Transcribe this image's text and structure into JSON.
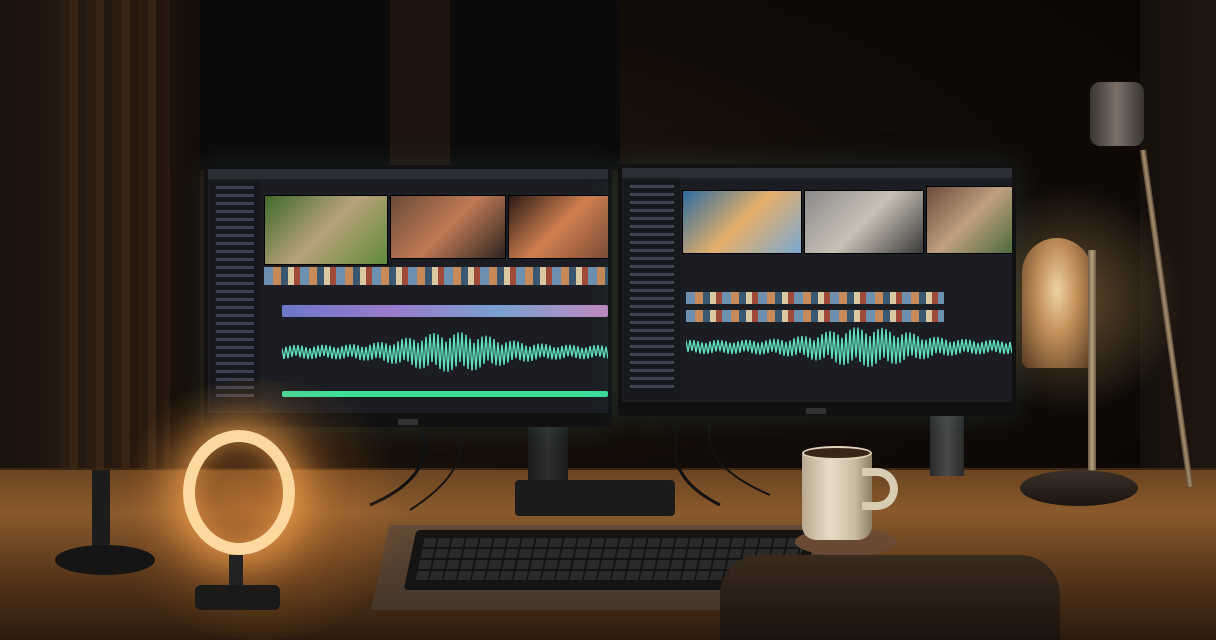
{
  "scene": {
    "colors": {
      "waveform": "#5fe0c0",
      "ring_light": "#ffd8a0",
      "desk_wood": "#8a5a2c",
      "timeline_green": "#3fdc9a"
    },
    "monitors": {
      "left": {
        "thumbnails": [
          {
            "colors": [
              "#3e6a2a",
              "#b9a27a",
              "#5f8b3a"
            ]
          },
          {
            "colors": [
              "#6a4a38",
              "#c07a55",
              "#2d2420"
            ]
          },
          {
            "colors": [
              "#2a1a14",
              "#d08050",
              "#7a4a34"
            ]
          }
        ]
      },
      "right": {
        "thumbnails": [
          {
            "colors": [
              "#2a6aa0",
              "#e6b06a",
              "#7aa8d0"
            ]
          },
          {
            "colors": [
              "#8a8a8a",
              "#c8c0b4",
              "#3a3a3a"
            ]
          },
          {
            "colors": [
              "#6a4a3a",
              "#c0a080",
              "#4a6a3a"
            ]
          }
        ]
      }
    }
  }
}
